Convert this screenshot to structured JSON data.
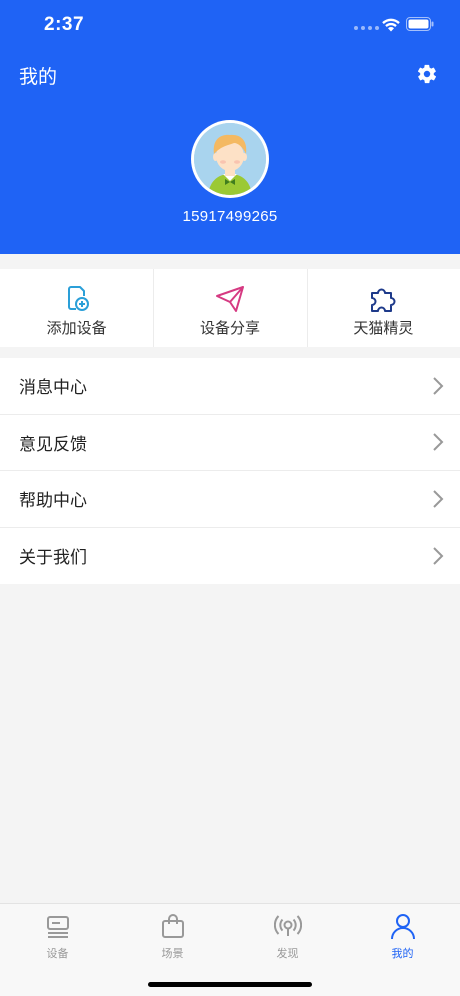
{
  "status_bar": {
    "time": "2:37"
  },
  "header": {
    "title": "我的",
    "phone": "15917499265",
    "settings_icon": "gear-icon"
  },
  "quick_actions": [
    {
      "label": "添加设备",
      "icon": "add-device-icon",
      "color": "#2a9fd8"
    },
    {
      "label": "设备分享",
      "icon": "paper-plane-icon",
      "color": "#d63a82"
    },
    {
      "label": "天猫精灵",
      "icon": "puzzle-icon",
      "color": "#1e3a8a"
    }
  ],
  "menu": [
    {
      "label": "消息中心"
    },
    {
      "label": "意见反馈"
    },
    {
      "label": "帮助中心"
    },
    {
      "label": "关于我们"
    }
  ],
  "tabbar": [
    {
      "label": "设备",
      "icon": "device-icon"
    },
    {
      "label": "场景",
      "icon": "bag-icon"
    },
    {
      "label": "发现",
      "icon": "broadcast-icon"
    },
    {
      "label": "我的",
      "icon": "person-icon",
      "active": true
    }
  ],
  "colors": {
    "primary": "#1f63f5",
    "background": "#f4f4f4"
  }
}
